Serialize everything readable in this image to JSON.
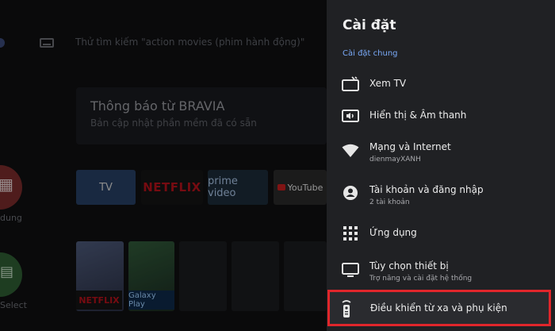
{
  "background": {
    "search_hint": "Thử tìm kiếm \"action movies (phim hành động)\"",
    "notification_title": "Thông báo từ BRAVIA",
    "notification_subtitle": "Bản cập nhật phần mềm đã có sẵn",
    "left_apps": [
      "dung",
      "Select"
    ],
    "app_tiles": [
      "TV",
      "NETFLIX",
      "prime video",
      "YouTube"
    ],
    "poster_labels": [
      "NETFLIX",
      "Galaxy Play"
    ]
  },
  "settings": {
    "title": "Cài đặt",
    "section": "Cài đặt chung",
    "items": [
      {
        "label": "Xem TV",
        "sub": "",
        "icon": "tv-antenna-icon"
      },
      {
        "label": "Hiển thị & Âm thanh",
        "sub": "",
        "icon": "display-sound-icon"
      },
      {
        "label": "Mạng và Internet",
        "sub": "dienmayXANH",
        "icon": "wifi-icon"
      },
      {
        "label": "Tài khoản và đăng nhập",
        "sub": "2 tài khoản",
        "icon": "account-icon"
      },
      {
        "label": "Ứng dụng",
        "sub": "",
        "icon": "apps-grid-icon"
      },
      {
        "label": "Tùy chọn thiết bị",
        "sub": "Trợ năng và cài đặt hệ thống",
        "icon": "monitor-icon"
      },
      {
        "label": "Điều khiển từ xa và phụ kiện",
        "sub": "",
        "icon": "remote-icon"
      }
    ]
  },
  "colors": {
    "panel_bg": "#202124",
    "accent_blue": "#7aaaf8",
    "highlight_red": "#e0262b"
  }
}
